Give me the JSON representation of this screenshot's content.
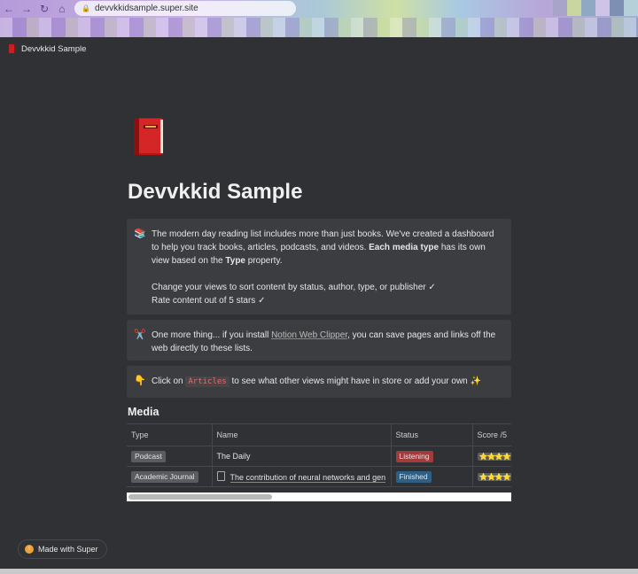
{
  "browser": {
    "url": "devvkkidsample.super.site",
    "nav_back": "←",
    "nav_forward": "→",
    "nav_reload": "↻",
    "nav_home": "⌂",
    "lock": "🔒"
  },
  "header": {
    "site_name": "Devvkkid Sample"
  },
  "page": {
    "title": "Devvkkid Sample"
  },
  "callouts": [
    {
      "emoji": "📚",
      "p1_a": "The modern day reading list includes more than just books. We've created a dashboard to help you track books, articles, podcasts, and videos. ",
      "p1_bold": "Each media type",
      "p1_b": " has its own view based on the ",
      "p1_bold2": "Type",
      "p1_c": " property.",
      "p2": "Change your views to sort content by status, author, type, or publisher ✓",
      "p3": "Rate content out of 5 stars ✓"
    },
    {
      "emoji": "✂️",
      "before": "One more thing... if you install ",
      "link": "Notion Web Clipper",
      "after": ", you can save pages and links off the web directly to these lists."
    },
    {
      "emoji": "👇",
      "before": "Click on ",
      "code": "Articles",
      "after": " to see what other views might have in store or add your own ✨"
    }
  ],
  "media": {
    "title": "Media",
    "columns": [
      "Type",
      "Name",
      "Status",
      "Score /5"
    ],
    "rows": [
      {
        "type": "Podcast",
        "name": "The Daily",
        "status": "Listening",
        "score": "⭐⭐⭐⭐"
      },
      {
        "type": "Academic Journal",
        "name": "The contribution of neural networks and gen",
        "status": "Finished",
        "score": "⭐⭐⭐⭐"
      }
    ]
  },
  "footer": {
    "made_with": "Made with Super",
    "badge_glyph": "↑"
  },
  "colors": {
    "background": "#2f3134",
    "callout": "#3b3d41",
    "status_listening": "#a13c3c",
    "status_finished": "#2f5f82",
    "code_text": "#e46c6c"
  }
}
